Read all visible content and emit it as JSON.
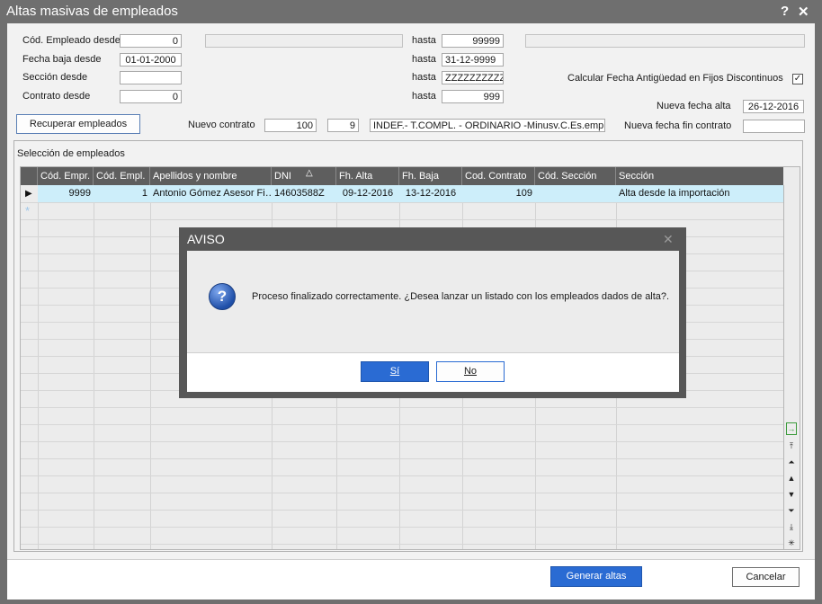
{
  "window": {
    "title": "Altas masivas de empleados",
    "help_label": "?",
    "close_label": "✕"
  },
  "filters": {
    "cod_empleado_label": "Cód. Empleado desde",
    "cod_empleado_from": "0",
    "cod_empleado_to": "99999",
    "fecha_baja_label": "Fecha baja desde",
    "fecha_baja_from": "01-01-2000",
    "fecha_baja_to": "31-12-9999",
    "seccion_label": "Sección desde",
    "seccion_from": "",
    "seccion_to": "ZZZZZZZZZZ",
    "contrato_label": "Contrato desde",
    "contrato_from": "0",
    "contrato_to": "999",
    "hasta_label": "hasta",
    "calc_label": "Calcular Fecha Antigüedad en Fijos Discontinuos",
    "calc_checked": "✓",
    "nueva_fecha_alta_label": "Nueva fecha alta",
    "nueva_fecha_alta": "26-12-2016",
    "nueva_fecha_fin_label": "Nueva fecha fin contrato",
    "nueva_fecha_fin": "",
    "recuperar_label": "Recuperar empleados",
    "nuevo_contrato_label": "Nuevo contrato",
    "nuevo_contrato_code": "100",
    "nuevo_contrato_sub": "9",
    "nuevo_contrato_desc": "INDEF.- T.COMPL. - ORDINARIO -Minusv.C.Es.empleo"
  },
  "grid": {
    "title": "Selección de empleados",
    "columns": [
      "Cód. Empr.",
      "Cód. Empl.",
      "Apellidos y nombre",
      "DNI",
      "Fh. Alta",
      "Fh. Baja",
      "Cod. Contrato",
      "Cód. Sección",
      "Sección"
    ],
    "sort_indicator": "△",
    "rows": [
      {
        "cod_empr": "9999",
        "cod_empl": "1",
        "nombre": "Antonio Gómez Asesor Fi…",
        "dni": "14603588Z",
        "fh_alta": "09-12-2016",
        "fh_baja": "13-12-2016",
        "cod_contrato": "109",
        "cod_seccion": "",
        "seccion": "Alta desde la importación"
      }
    ],
    "row_indicator": "▶",
    "new_row_indicator": "*"
  },
  "nav": {
    "first": "⤒",
    "prev_page": "⏶",
    "prev": "▲",
    "next": "▼",
    "next_page": "⏷",
    "last": "⤓",
    "new": "✳",
    "export": "→"
  },
  "dialog": {
    "title": "AVISO",
    "close_label": "✕",
    "icon": "?",
    "message": "Proceso finalizado correctamente. ¿Desea lanzar un listado con los empleados dados de alta?.",
    "yes_label": "Sí",
    "no_label": "No"
  },
  "footer": {
    "generar_label": "Generar altas",
    "cancelar_label": "Cancelar"
  },
  "colors": {
    "accent": "#2a6bd3",
    "title_bg": "#6f6f6f",
    "grid_header": "#5e5e5e",
    "selected_row": "#cdeefa"
  }
}
